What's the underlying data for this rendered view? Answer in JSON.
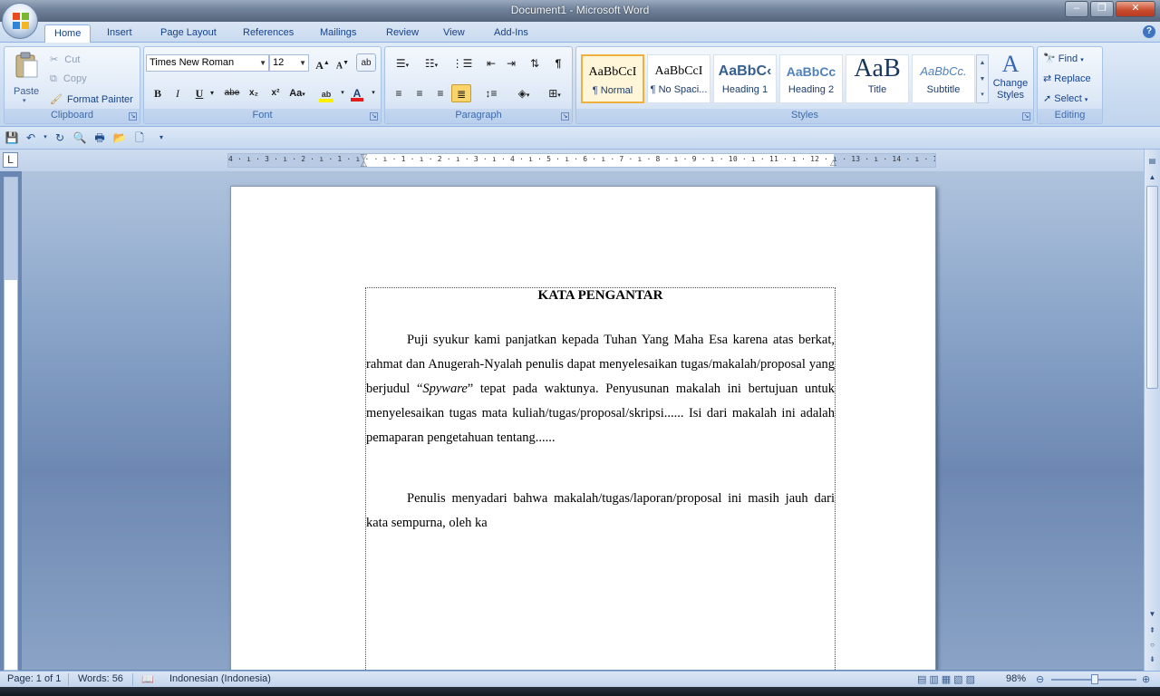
{
  "window": {
    "title": "Document1 - Microsoft Word",
    "minimize": "–",
    "restore": "❐",
    "close": "✕"
  },
  "tabs": [
    {
      "label": "Home",
      "active": true
    },
    {
      "label": "Insert"
    },
    {
      "label": "Page Layout"
    },
    {
      "label": "References"
    },
    {
      "label": "Mailings"
    },
    {
      "label": "Review"
    },
    {
      "label": "View"
    },
    {
      "label": "Add-Ins"
    }
  ],
  "help": "?",
  "clipboard": {
    "label": "Clipboard",
    "paste": "Paste",
    "cut": "Cut",
    "copy": "Copy",
    "format_painter": "Format Painter"
  },
  "font": {
    "label": "Font",
    "name": "Times New Roman",
    "size": "12",
    "bold": "B",
    "italic": "I",
    "underline": "U",
    "strike": "abe",
    "sub": "x₂",
    "sup": "x²",
    "case": "Aa",
    "grow": "A",
    "shrink": "A",
    "clear": "ab"
  },
  "paragraph": {
    "label": "Paragraph"
  },
  "styles": {
    "label": "Styles",
    "change": "Change Styles",
    "items": [
      {
        "sample": "AaBbCcI",
        "name": "¶ Normal"
      },
      {
        "sample": "AaBbCcI",
        "name": "¶ No Spaci..."
      },
      {
        "sample": "AaBbC‹",
        "name": "Heading 1"
      },
      {
        "sample": "AaBbCc",
        "name": "Heading 2"
      },
      {
        "sample": "AaB",
        "name": "Title"
      },
      {
        "sample": "AaBbCc.",
        "name": "Subtitle"
      }
    ]
  },
  "editing": {
    "label": "Editing",
    "find": "Find",
    "replace": "Replace",
    "select": "Select"
  },
  "ruler": {
    "ticks": "4 · ı · 3 · ı · 2 · ı · 1 · ı ·   · ı · 1 · ı · 2 · ı · 3 · ı · 4 · ı · 5 · ı · 6 · ı · 7 · ı · 8 · ı · 9 · ı · 10 · ı · 11 · ı · 12 · ı · 13 · ı · 14 · ı · 15 · ı · 16 · ı"
  },
  "document": {
    "title": "KATA PENGANTAR",
    "para1_start": "Puji syukur kami panjatkan kepada Tuhan Yang Maha Esa karena atas berkat, rahmat dan Anugerah-Nyalah penulis dapat menyelesaikan tugas/makalah/proposal yang berjudul “",
    "para1_italic": "Spyware",
    "para1_end": "” tepat pada waktunya. Penyusunan makalah ini bertujuan untuk menyelesaikan tugas mata kuliah/tugas/proposal/skripsi...... Isi dari makalah ini adalah pemaparan pengetahuan tentang......",
    "para2": "Penulis menyadari bahwa makalah/tugas/laporan/proposal ini masih jauh dari kata sempurna, oleh ka"
  },
  "status": {
    "page": "Page: 1 of 1",
    "words": "Words: 56",
    "language": "Indonesian (Indonesia)",
    "zoom": "98%"
  }
}
